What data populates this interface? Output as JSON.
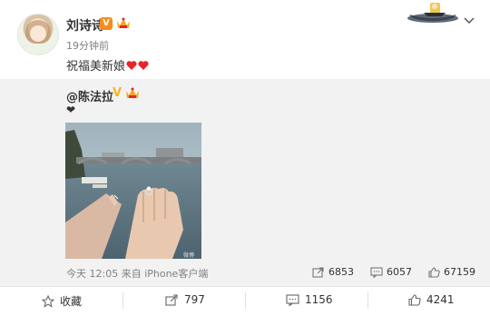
{
  "post": {
    "author": "刘诗诗",
    "verified_badge": "V",
    "time": "19分钟前",
    "text": "祝福美新娘",
    "emoji_icon": "red-heart-icon"
  },
  "repost": {
    "author": "@陈法拉",
    "verified_badge": "V",
    "text": "❤",
    "photo_watermark": "微博",
    "time_source": "今天 12:05 来自 iPhone客户端",
    "reposts": "6853",
    "comments": "6057",
    "likes": "67159"
  },
  "actions": {
    "favorite": "收藏",
    "repost": "797",
    "comment": "1156",
    "like": "4241"
  },
  "colors": {
    "verified_orange": "#f78b1c",
    "heart_red": "#e8242b",
    "repost_bg": "#f2f2f2",
    "meta_gray": "#808080"
  }
}
